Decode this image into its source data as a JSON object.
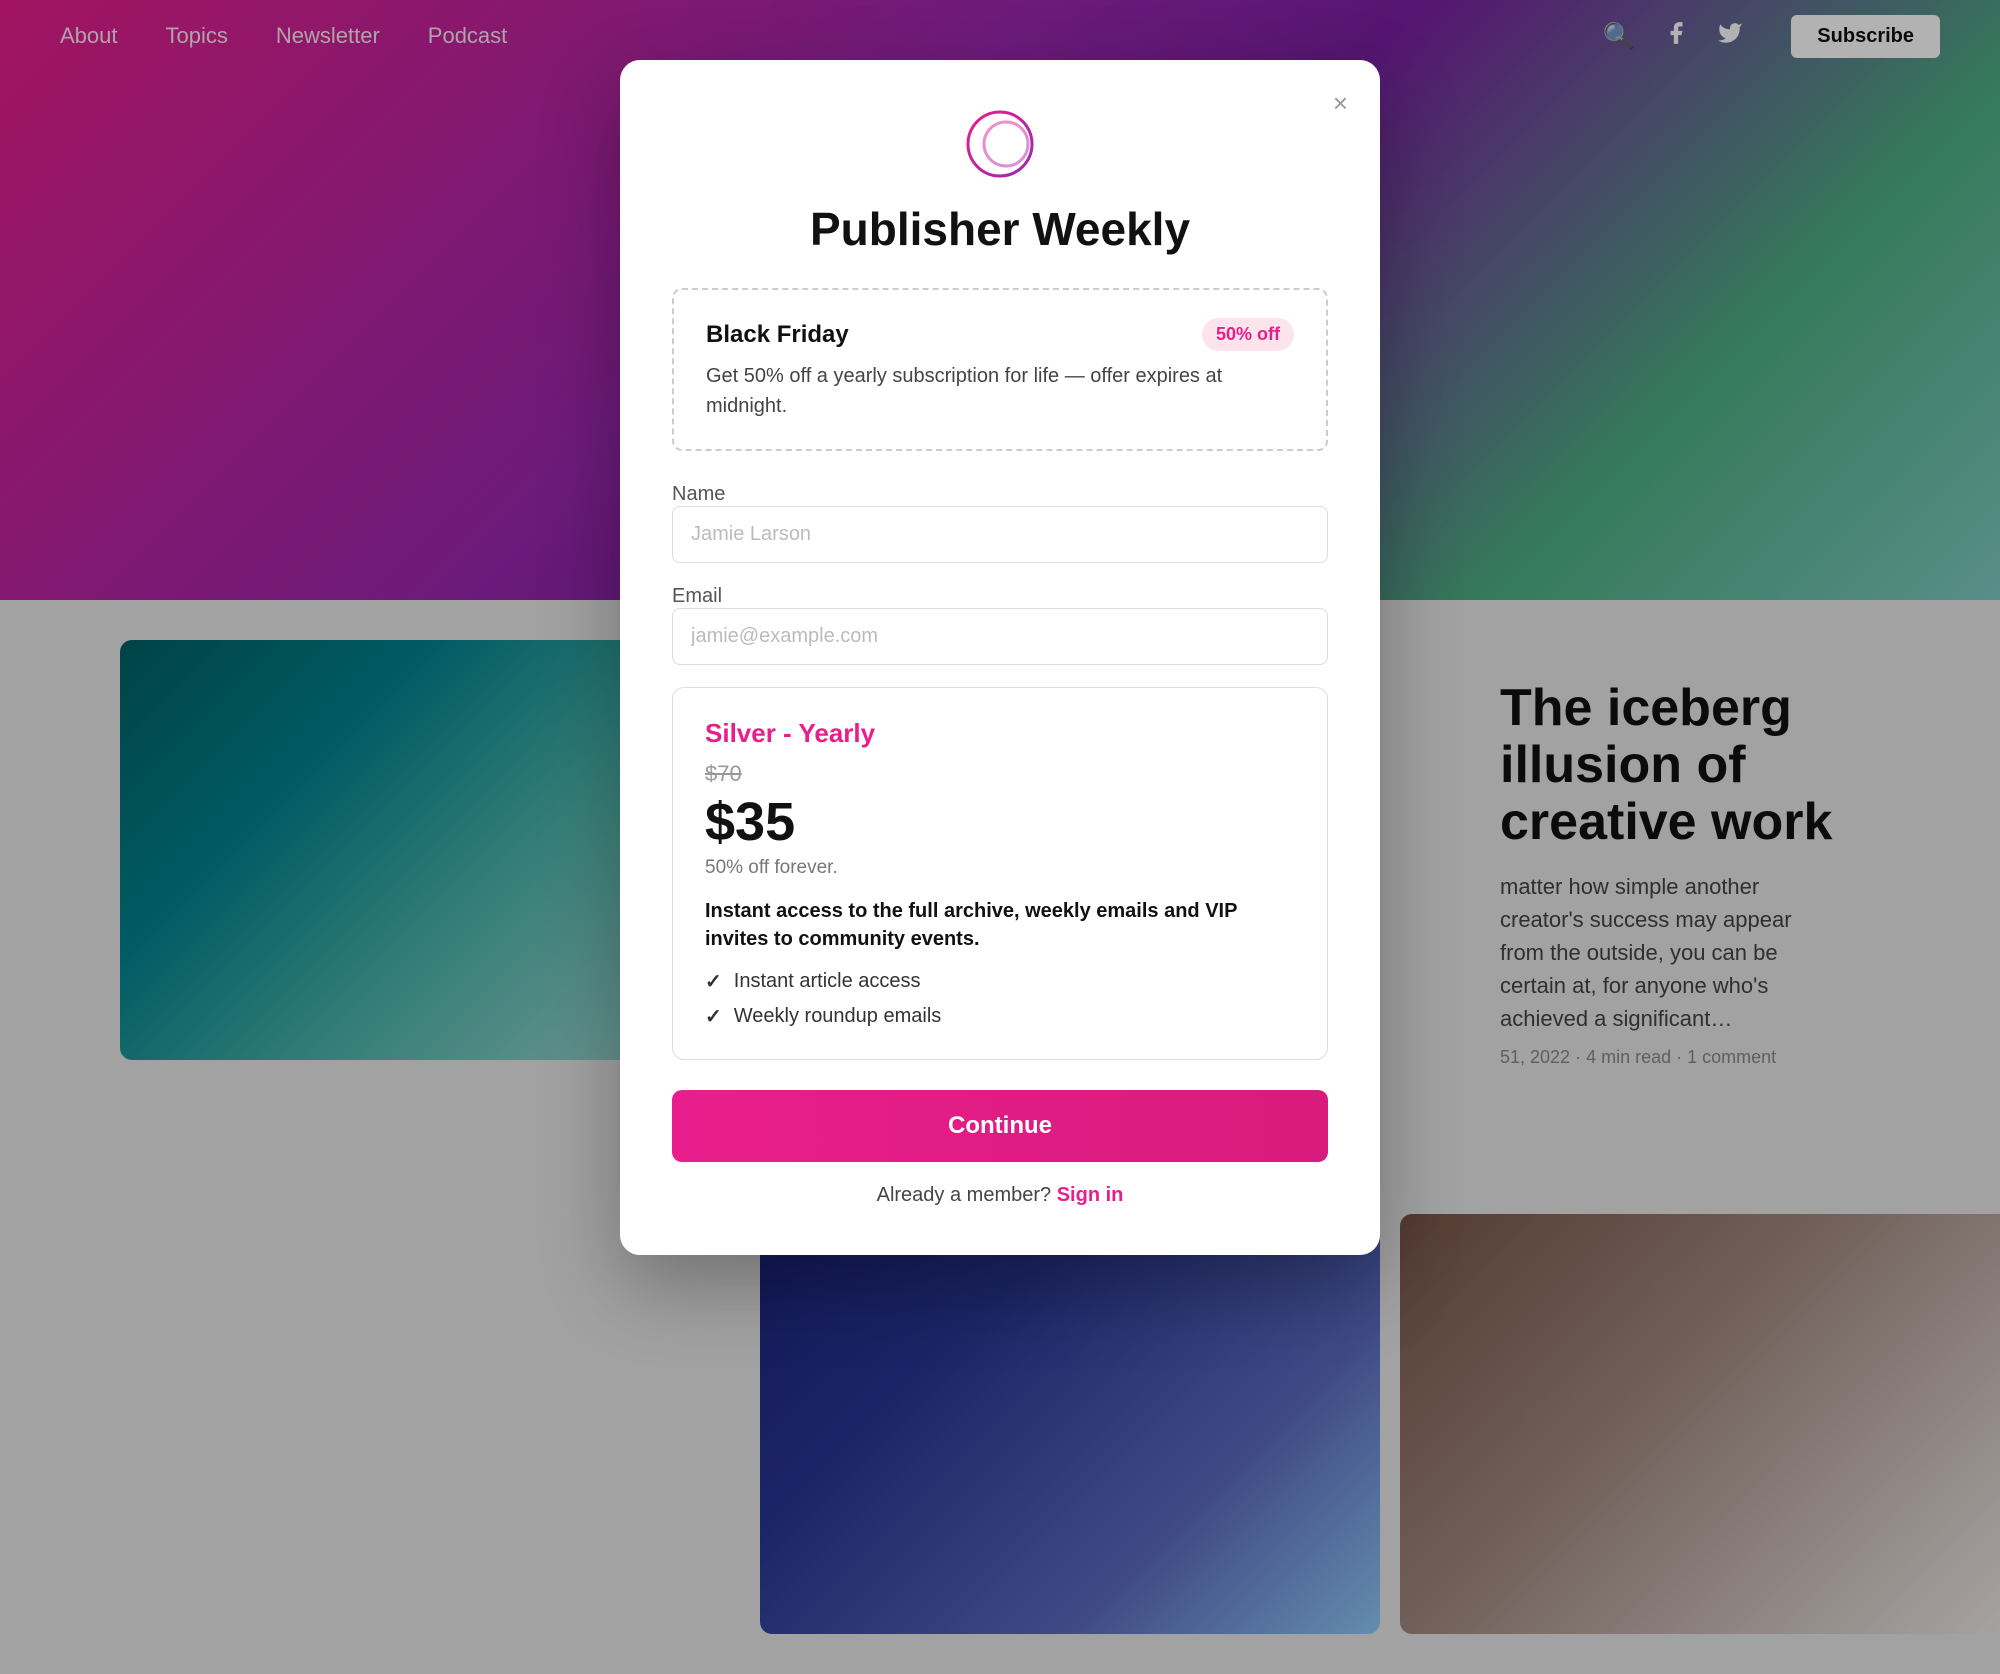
{
  "navbar": {
    "links": [
      {
        "label": "About"
      },
      {
        "label": "Topics"
      },
      {
        "label": "Newsletter"
      },
      {
        "label": "Podcast"
      }
    ],
    "subscribe_label": "Subscribe"
  },
  "modal": {
    "title": "Publisher Weekly",
    "close_label": "×",
    "promo": {
      "title": "Black Friday",
      "badge": "50% off",
      "description": "Get 50% off a yearly subscription for life — offer expires at midnight."
    },
    "fields": {
      "name_label": "Name",
      "name_placeholder": "Jamie Larson",
      "email_label": "Email",
      "email_placeholder": "jamie@example.com"
    },
    "plan": {
      "name": "Silver - Yearly",
      "original_price": "$70",
      "price": "$35",
      "discount": "50% off forever.",
      "description": "Instant access to the full archive, weekly emails and VIP invites to community events.",
      "features": [
        "Instant article access",
        "Weekly roundup emails"
      ]
    },
    "continue_label": "Continue",
    "already_member": "Already a member?",
    "sign_in_label": "Sign in"
  },
  "article": {
    "title": "The iceberg illusion of creative work",
    "excerpt": "matter how simple another creator's success may appear from the outside, you can be certain at, for anyone who's achieved a significant…",
    "meta": "51, 2022 · 4 min read · 1 comment"
  }
}
